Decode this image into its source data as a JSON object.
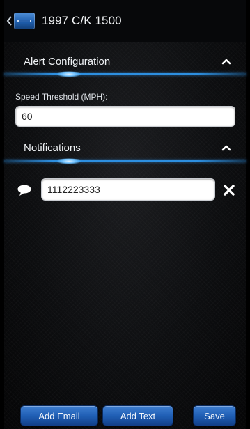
{
  "header": {
    "title": "1997 C/K 1500",
    "back_icon": "chevron-left-icon",
    "app_icon": "app-logo-icon"
  },
  "alert_configuration": {
    "title": "Alert Configuration",
    "collapse_icon": "chevron-up-icon",
    "speed_threshold_label": "Speed Threshold (MPH):",
    "speed_threshold_value": "60"
  },
  "notifications": {
    "title": "Notifications",
    "collapse_icon": "chevron-up-icon",
    "items": [
      {
        "type_icon": "chat-bubble-icon",
        "value": "1112223333",
        "remove_icon": "close-icon"
      }
    ]
  },
  "buttons": {
    "add_email": "Add Email",
    "add_text": "Add Text",
    "save": "Save"
  },
  "colors": {
    "accent": "#2d8fe0",
    "button": "#205fb5",
    "background": "#0d0e10"
  }
}
